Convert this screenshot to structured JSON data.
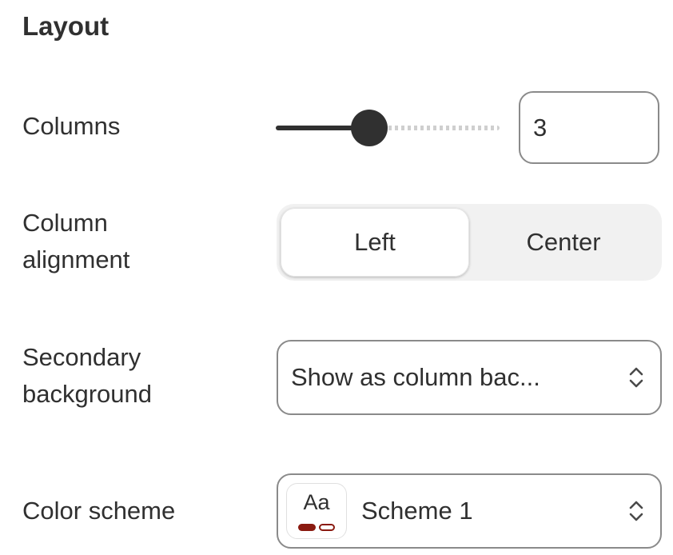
{
  "section": {
    "title": "Layout"
  },
  "columns": {
    "label": "Columns",
    "value": "3",
    "slider_fraction": 0.42
  },
  "column_alignment": {
    "label_line1": "Column",
    "label_line2": "alignment",
    "options": [
      "Left",
      "Center"
    ],
    "selected": "Left"
  },
  "secondary_background": {
    "label_line1": "Secondary",
    "label_line2": "background",
    "value": "Show as column bac..."
  },
  "color_scheme": {
    "label": "Color scheme",
    "swatch_text": "Aa",
    "value": "Scheme 1",
    "colors": {
      "primary": "#8a1a10",
      "background": "#ffffff"
    }
  },
  "icons": {
    "select": "chevron-up-down-icon"
  }
}
